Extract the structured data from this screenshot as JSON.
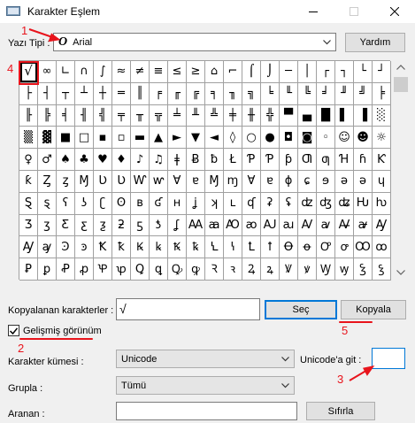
{
  "window": {
    "title": "Karakter Eşlem"
  },
  "font": {
    "label": "Yazı Tipi :",
    "value": "Arial",
    "glyph": "O",
    "help_button": "Yardım"
  },
  "grid": {
    "rows": [
      [
        "√",
        "∞",
        "∟",
        "∩",
        "∫",
        "≈",
        "≠",
        "≡",
        "≤",
        "≥",
        "⌂",
        "⌐",
        "⌠",
        "⌡",
        "─",
        "│",
        "┌",
        "┐",
        "└",
        "┘"
      ],
      [
        "├",
        "┤",
        "┬",
        "┴",
        "┼",
        "═",
        "║",
        "╒",
        "╓",
        "╔",
        "╕",
        "╖",
        "╗",
        "╘",
        "╙",
        "╚",
        "╛",
        "╜",
        "╝",
        "╞"
      ],
      [
        "╟",
        "╠",
        "╡",
        "╢",
        "╣",
        "╤",
        "╥",
        "╦",
        "╧",
        "╨",
        "╩",
        "╪",
        "╫",
        "╬",
        "▀",
        "▄",
        "█",
        "▌",
        "▐",
        "░"
      ],
      [
        "▒",
        "▓",
        "■",
        "□",
        "▪",
        "▫",
        "▬",
        "▲",
        "►",
        "▼",
        "◄",
        "◊",
        "○",
        "●",
        "◘",
        "◙",
        "◦",
        "☺",
        "☻",
        "☼"
      ],
      [
        "♀",
        "♂",
        "♠",
        "♣",
        "♥",
        "♦",
        "♪",
        "♫",
        "ǂ",
        "Ƀ",
        "ƀ",
        "Ł",
        "Ƥ",
        "Ƥ",
        "ƥ",
        "Ƣ",
        "ƣ",
        "Ɦ",
        "ɦ",
        "Ƙ"
      ],
      [
        "ƙ",
        "Ȥ",
        "ȥ",
        "Ɱ",
        "Ʋ",
        "Ʋ",
        "Ⱳ",
        "ⱳ",
        "Ɐ",
        "ɐ",
        "Ɱ",
        "ɱ",
        "Ɐ",
        "ɐ",
        "ɸ",
        "ɕ",
        "ɘ",
        "ə",
        "ǝ",
        "ɥ"
      ],
      [
        "Ȿ",
        "ȿ",
        "ʕ",
        "ʖ",
        "ʗ",
        "ʘ",
        "ʙ",
        "ʛ",
        "ʜ",
        "ʝ",
        "ʞ",
        "ʟ",
        "ʠ",
        "ʡ",
        "ʢ",
        "ʣ",
        "ʤ",
        "ʥ",
        "Ƕ",
        "ƕ"
      ],
      [
        "Ʒ",
        "ʒ",
        "Ƹ",
        "ƹ",
        "ƺ",
        "ƻ",
        "ƽ",
        "ƾ",
        "ʆ",
        "Ꜳ",
        "ꜳ",
        "Ꜵ",
        "ꜵ",
        "Ꜷ",
        "ꜷ",
        "Ꜹ",
        "ꜹ",
        "Ꜻ",
        "ꜻ",
        "Ꜽ"
      ],
      [
        "Ꜽ",
        "ꜽ",
        "Ꜿ",
        "ꜿ",
        "Ꝁ",
        "ꝁ",
        "Ꝃ",
        "ꝃ",
        "Ꝅ",
        "ꝅ",
        "Ꝇ",
        "ꝇ",
        "Ꝉ",
        "ꝉ",
        "Ꝋ",
        "ꝋ",
        "Ꝍ",
        "ꝍ",
        "Ꝏ",
        "ꝏ"
      ],
      [
        "Ꝑ",
        "ꝑ",
        "Ꝓ",
        "ꝓ",
        "Ꝕ",
        "ꝕ",
        "Ꝗ",
        "ꝗ",
        "Ꝙ",
        "ꝙ",
        "Ꝛ",
        "ꝛ",
        "Ꝝ",
        "ꝝ",
        "Ꝟ",
        "ꝟ",
        "Ꝡ",
        "ꝡ",
        "Ꝣ",
        "ꝣ"
      ]
    ]
  },
  "copy": {
    "label": "Kopyalanan karakterler :",
    "value": "√",
    "select_button": "Seç",
    "copy_button": "Kopyala"
  },
  "advanced": {
    "label": "Gelişmiş görünüm",
    "checked": true
  },
  "charset": {
    "label": "Karakter kümesi :",
    "value": "Unicode",
    "goto_label": "Unicode'a git :",
    "goto_value": ""
  },
  "group": {
    "label": "Grupla :",
    "value": "Tümü"
  },
  "search": {
    "label": "Aranan :",
    "value": "",
    "clear_button": "Sıfırla"
  },
  "annotations": {
    "n1": "1",
    "n2": "2",
    "n3": "3",
    "n4": "4",
    "n5": "5",
    "color": "#e8141c"
  }
}
